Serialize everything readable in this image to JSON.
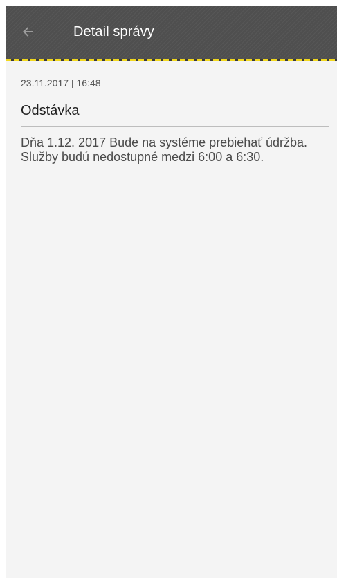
{
  "app_bar": {
    "title": "Detail správy",
    "back_icon": "back-arrow-icon"
  },
  "message": {
    "datetime": "23.11.2017 | 16:48",
    "subject": "Odstávka",
    "body": "Dňa 1.12. 2017 Bude na systéme prebiehať údržba. Služby budú nedostupné medzi 6:00 a 6:30."
  },
  "colors": {
    "app_bar_bg": "#4f4f4f",
    "accent_yellow": "#f2d81e",
    "content_bg": "#f4f4f4",
    "divider": "#bdbdbd"
  }
}
